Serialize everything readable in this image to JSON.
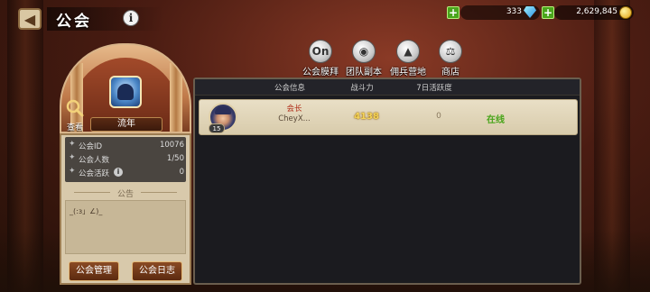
{
  "header": {
    "title": "公会",
    "back_icon": "back-arrow-icon",
    "info_icon": "info-icon",
    "info_glyph": "i",
    "back_glyph": "◀"
  },
  "resources": {
    "gems": {
      "value": "333",
      "icon": "diamond-icon"
    },
    "gold": {
      "value": "2,629,845",
      "icon": "gold-coin-icon"
    },
    "plus_glyph": "+"
  },
  "nav": [
    {
      "label": "公会膜拜",
      "icon": "worship-icon",
      "glyph": "On"
    },
    {
      "label": "团队副本",
      "icon": "team-dungeon-icon",
      "glyph": "◉"
    },
    {
      "label": "佣兵营地",
      "icon": "mercenary-camp-icon",
      "glyph": "▲"
    },
    {
      "label": "商店",
      "icon": "scales-shop-icon",
      "glyph": "⚖"
    }
  ],
  "guild": {
    "name": "流年",
    "search_label": "查看",
    "emblem_icon": "guild-emblem-icon",
    "stats": [
      {
        "label": "公会ID",
        "value": "10076"
      },
      {
        "label": "公会人数",
        "value": "1/50"
      },
      {
        "label": "公会活跃",
        "value": "0"
      }
    ],
    "stat_info_glyph": "i",
    "notice_title": "公告",
    "notice_text": "_(:з」∠)_",
    "manage_button": "公会管理",
    "log_button": "公会日志"
  },
  "members": {
    "columns": [
      "公会信息",
      "战斗力",
      "7日活跃度"
    ],
    "rows": [
      {
        "role": "会长",
        "name": "CheyX...",
        "level": "15",
        "power": "4138",
        "activity": "0",
        "status": "在线"
      }
    ]
  },
  "colors": {
    "online": "#4aa51c",
    "leader_role": "#b12f1a",
    "power": "#f5d55a",
    "panel_border": "#6a5e4e"
  }
}
